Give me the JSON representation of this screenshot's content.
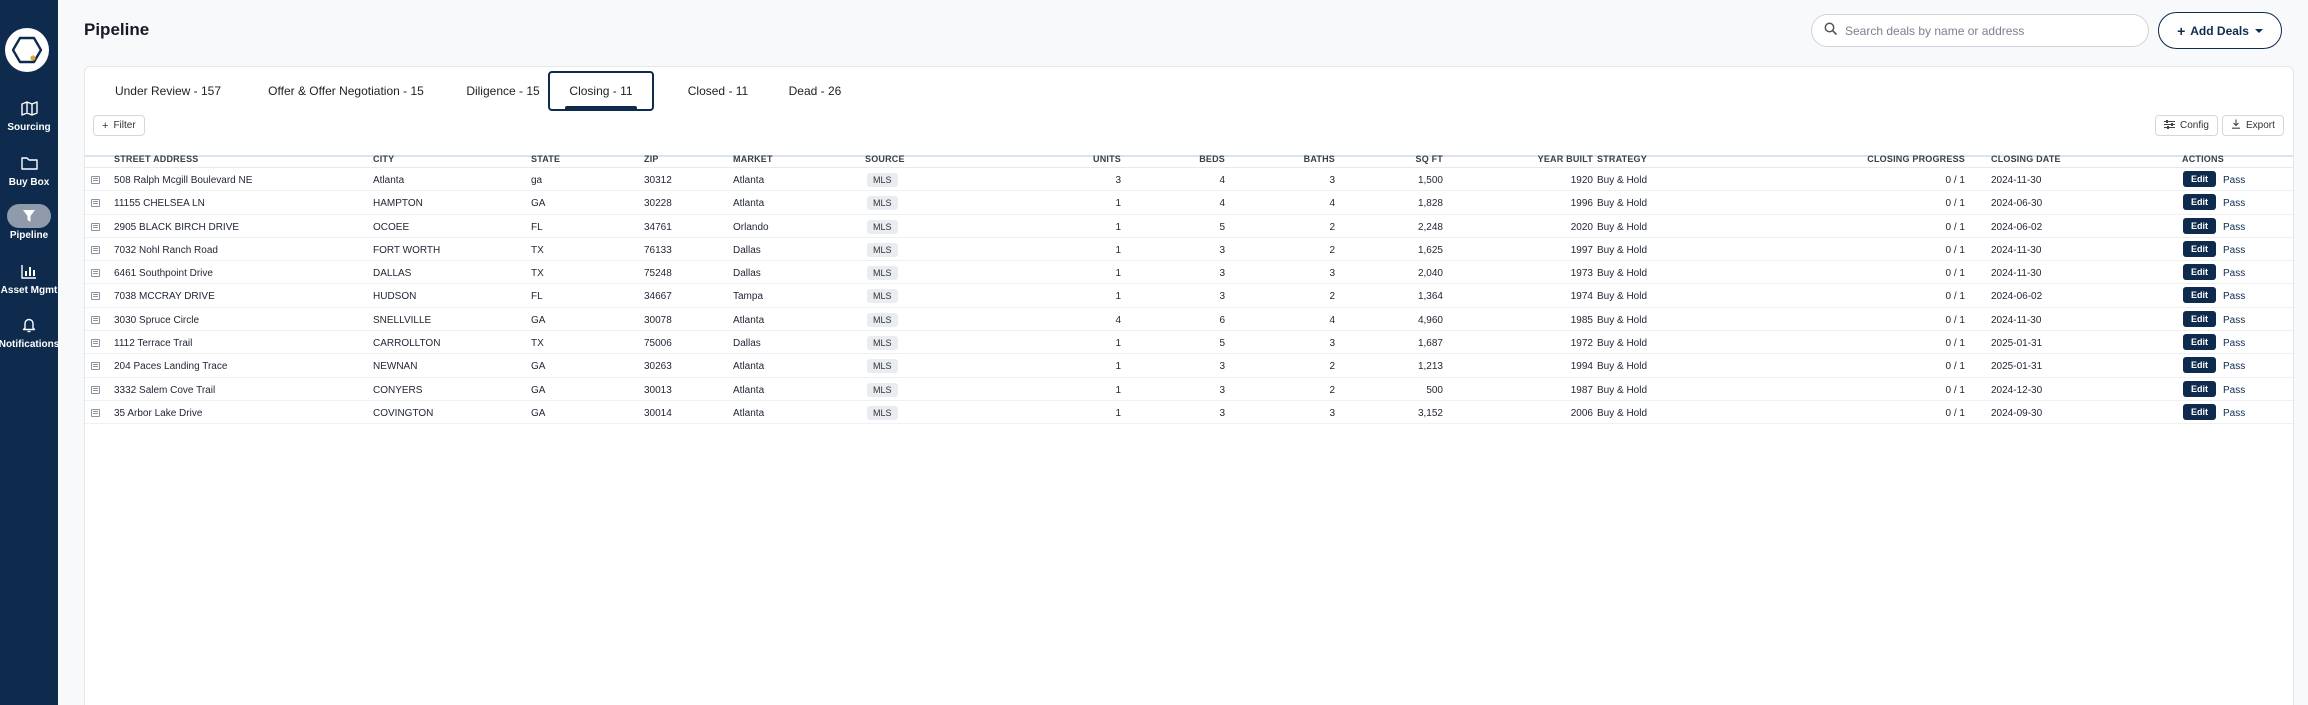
{
  "sidebar": {
    "logo_icon": "hexagon-logo-icon",
    "items": [
      {
        "label": "Sourcing",
        "icon": "map-icon",
        "active": false
      },
      {
        "label": "Buy Box",
        "icon": "folder-icon",
        "active": false
      },
      {
        "label": "Pipeline",
        "icon": "filter-icon",
        "active": true
      },
      {
        "label": "Asset Mgmt",
        "icon": "bar-chart-icon",
        "active": false
      },
      {
        "label": "Notifications",
        "icon": "bell-icon",
        "active": false
      }
    ]
  },
  "header": {
    "title": "Pipeline",
    "search_placeholder": "Search deals by name or address",
    "add_deals_label": "Add Deals"
  },
  "tabs": [
    {
      "label": "Under Review - 157",
      "active": false
    },
    {
      "label": "Offer & Offer Negotiation - 15",
      "active": false
    },
    {
      "label": "Diligence - 15",
      "active": false
    },
    {
      "label": "Closing - 11",
      "active": true
    },
    {
      "label": "Closed - 11",
      "active": false
    },
    {
      "label": "Dead - 26",
      "active": false
    }
  ],
  "toolbar": {
    "filter_label": "Filter",
    "config_label": "Config",
    "export_label": "Export"
  },
  "table": {
    "columns": [
      "STREET ADDRESS",
      "CITY",
      "STATE",
      "ZIP",
      "MARKET",
      "SOURCE",
      "UNITS",
      "BEDS",
      "BATHS",
      "SQ FT",
      "YEAR BUILT",
      "STRATEGY",
      "CLOSING PROGRESS",
      "CLOSING DATE",
      "ACTIONS"
    ],
    "edit_label": "Edit",
    "pass_label": "Pass",
    "rows": [
      {
        "address": "508 Ralph Mcgill Boulevard NE",
        "city": "Atlanta",
        "state": "ga",
        "zip": "30312",
        "market": "Atlanta",
        "source": "MLS",
        "units": "3",
        "beds": "4",
        "baths": "3",
        "sqft": "1,500",
        "year": "1920",
        "strategy": "Buy & Hold",
        "progress": "0 / 1",
        "date": "2024-11-30"
      },
      {
        "address": "11155 CHELSEA LN",
        "city": "HAMPTON",
        "state": "GA",
        "zip": "30228",
        "market": "Atlanta",
        "source": "MLS",
        "units": "1",
        "beds": "4",
        "baths": "4",
        "sqft": "1,828",
        "year": "1996",
        "strategy": "Buy & Hold",
        "progress": "0 / 1",
        "date": "2024-06-30"
      },
      {
        "address": "2905 BLACK BIRCH DRIVE",
        "city": "OCOEE",
        "state": "FL",
        "zip": "34761",
        "market": "Orlando",
        "source": "MLS",
        "units": "1",
        "beds": "5",
        "baths": "2",
        "sqft": "2,248",
        "year": "2020",
        "strategy": "Buy & Hold",
        "progress": "0 / 1",
        "date": "2024-06-02"
      },
      {
        "address": "7032 Nohl Ranch Road",
        "city": "FORT WORTH",
        "state": "TX",
        "zip": "76133",
        "market": "Dallas",
        "source": "MLS",
        "units": "1",
        "beds": "3",
        "baths": "2",
        "sqft": "1,625",
        "year": "1997",
        "strategy": "Buy & Hold",
        "progress": "0 / 1",
        "date": "2024-11-30"
      },
      {
        "address": "6461 Southpoint Drive",
        "city": "DALLAS",
        "state": "TX",
        "zip": "75248",
        "market": "Dallas",
        "source": "MLS",
        "units": "1",
        "beds": "3",
        "baths": "3",
        "sqft": "2,040",
        "year": "1973",
        "strategy": "Buy & Hold",
        "progress": "0 / 1",
        "date": "2024-11-30"
      },
      {
        "address": "7038 MCCRAY DRIVE",
        "city": "HUDSON",
        "state": "FL",
        "zip": "34667",
        "market": "Tampa",
        "source": "MLS",
        "units": "1",
        "beds": "3",
        "baths": "2",
        "sqft": "1,364",
        "year": "1974",
        "strategy": "Buy & Hold",
        "progress": "0 / 1",
        "date": "2024-06-02"
      },
      {
        "address": "3030 Spruce Circle",
        "city": "SNELLVILLE",
        "state": "GA",
        "zip": "30078",
        "market": "Atlanta",
        "source": "MLS",
        "units": "4",
        "beds": "6",
        "baths": "4",
        "sqft": "4,960",
        "year": "1985",
        "strategy": "Buy & Hold",
        "progress": "0 / 1",
        "date": "2024-11-30"
      },
      {
        "address": "1112 Terrace Trail",
        "city": "CARROLLTON",
        "state": "TX",
        "zip": "75006",
        "market": "Dallas",
        "source": "MLS",
        "units": "1",
        "beds": "5",
        "baths": "3",
        "sqft": "1,687",
        "year": "1972",
        "strategy": "Buy & Hold",
        "progress": "0 / 1",
        "date": "2025-01-31"
      },
      {
        "address": "204 Paces Landing Trace",
        "city": "NEWNAN",
        "state": "GA",
        "zip": "30263",
        "market": "Atlanta",
        "source": "MLS",
        "units": "1",
        "beds": "3",
        "baths": "2",
        "sqft": "1,213",
        "year": "1994",
        "strategy": "Buy & Hold",
        "progress": "0 / 1",
        "date": "2025-01-31"
      },
      {
        "address": "3332 Salem Cove Trail",
        "city": "CONYERS",
        "state": "GA",
        "zip": "30013",
        "market": "Atlanta",
        "source": "MLS",
        "units": "1",
        "beds": "3",
        "baths": "2",
        "sqft": "500",
        "year": "1987",
        "strategy": "Buy & Hold",
        "progress": "0 / 1",
        "date": "2024-12-30"
      },
      {
        "address": "35 Arbor Lake Drive",
        "city": "COVINGTON",
        "state": "GA",
        "zip": "30014",
        "market": "Atlanta",
        "source": "MLS",
        "units": "1",
        "beds": "3",
        "baths": "3",
        "sqft": "3,152",
        "year": "2006",
        "strategy": "Buy & Hold",
        "progress": "0 / 1",
        "date": "2024-09-30"
      }
    ]
  }
}
